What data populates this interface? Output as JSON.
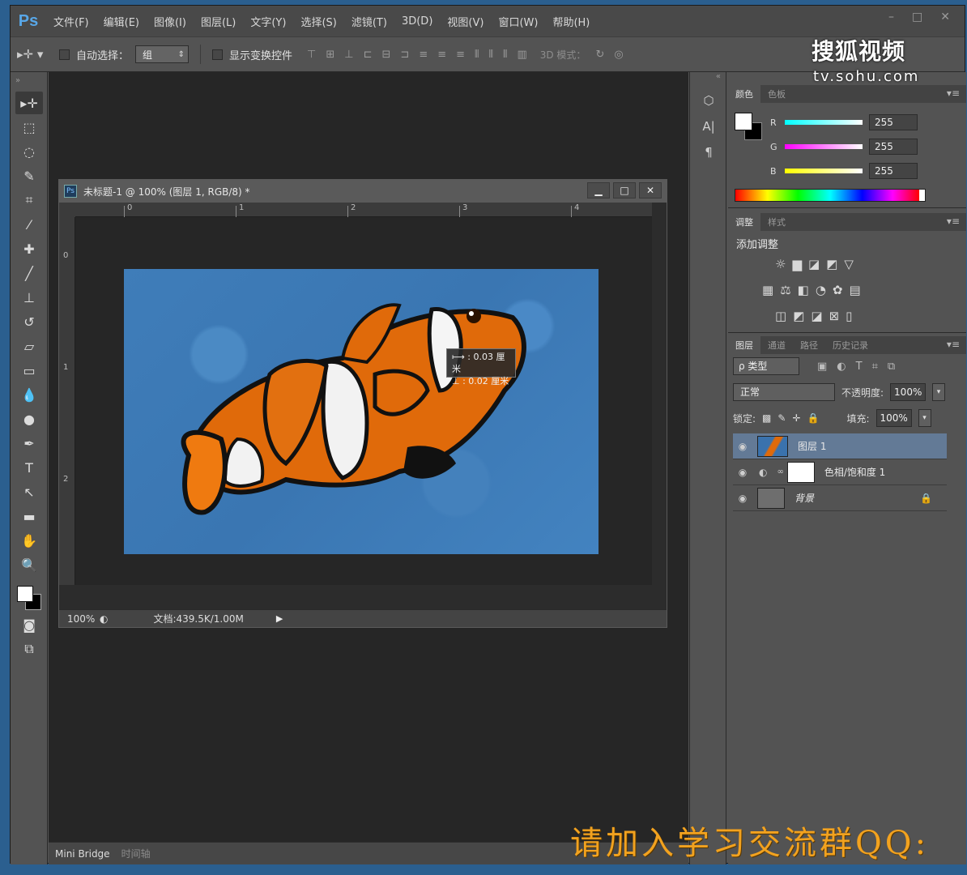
{
  "app": {
    "logo": "Ps",
    "menu": [
      "文件(F)",
      "编辑(E)",
      "图像(I)",
      "图层(L)",
      "文字(Y)",
      "选择(S)",
      "滤镜(T)",
      "3D(D)",
      "视图(V)",
      "窗口(W)",
      "帮助(H)"
    ],
    "window_controls": [
      "–",
      "□",
      "✕"
    ]
  },
  "options": {
    "auto_select_label": "自动选择：",
    "auto_select_value": "组",
    "show_transform_label": "显示变换控件",
    "mode3d_label": "3D 模式："
  },
  "document": {
    "title": "未标题-1 @ 100% (图层 1, RGB/8) *",
    "ruler_h": [
      "0",
      "1",
      "2",
      "3",
      "4"
    ],
    "ruler_v": [
      "0",
      "1",
      "2"
    ],
    "measure_x": "⟼ : 0.03 厘米",
    "measure_y": "⊥ : 0.02 厘米",
    "zoom": "100%",
    "doc_info": "文档:439.5K/1.00M"
  },
  "bottom_tabs": [
    "Mini Bridge",
    "时间轴"
  ],
  "color_panel": {
    "tabs": [
      "颜色",
      "色板"
    ],
    "channels": [
      {
        "name": "R",
        "value": "255",
        "color": "#00e5e5"
      },
      {
        "name": "G",
        "value": "255",
        "color": "#ff2fd0"
      },
      {
        "name": "B",
        "value": "255",
        "color": "#ffff00"
      }
    ]
  },
  "adjust_panel": {
    "tabs": [
      "调整",
      "样式"
    ],
    "title": "添加调整"
  },
  "layers_panel": {
    "tabs": [
      "图层",
      "通道",
      "路径",
      "历史记录"
    ],
    "kind": "ρ 类型",
    "blend_mode": "正常",
    "opacity_label": "不透明度:",
    "opacity": "100%",
    "lock_label": "锁定:",
    "fill_label": "填充:",
    "fill": "100%",
    "layers": [
      {
        "name": "图层 1",
        "selected": true
      },
      {
        "name": "色相/饱和度 1",
        "selected": false
      },
      {
        "name": "背景",
        "selected": false
      }
    ]
  },
  "watermark": {
    "logo": "搜狐视频",
    "url": "tv.sohu.com",
    "qq_text": "请加入学习交流群QQ:"
  }
}
